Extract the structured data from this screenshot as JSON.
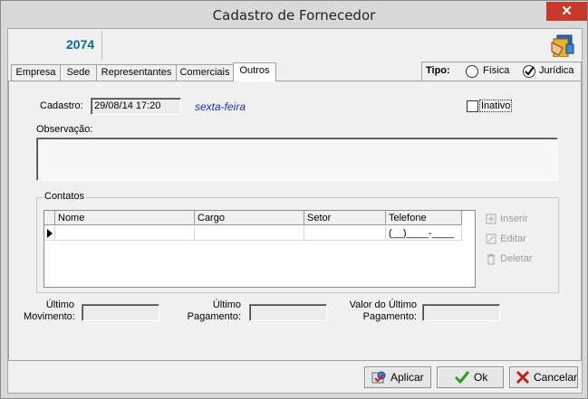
{
  "window": {
    "title": "Cadastro de Fornecedor",
    "close_symbol": "✕"
  },
  "header": {
    "code": "2074"
  },
  "tabs": [
    {
      "label": "Empresa",
      "active": false
    },
    {
      "label": "Sede",
      "active": false
    },
    {
      "label": "Representantes",
      "active": false
    },
    {
      "label": "Comerciais",
      "active": false
    },
    {
      "label": "Outros",
      "active": true
    }
  ],
  "tipo": {
    "label": "Tipo:",
    "options": [
      {
        "label": "Física",
        "selected": false
      },
      {
        "label": "Jurídica",
        "selected": true
      }
    ]
  },
  "cadastro": {
    "label": "Cadastro:",
    "value": "29/08/14 17:20",
    "weekday": "sexta-feira"
  },
  "inativo": {
    "label": "Inativo",
    "checked": false
  },
  "observacao": {
    "label": "Observação:",
    "value": ""
  },
  "contatos": {
    "legend": "Contatos",
    "columns": [
      "Nome",
      "Cargo",
      "Setor",
      "Telefone"
    ],
    "rows": [
      {
        "nome": "",
        "cargo": "",
        "setor": "",
        "telefone": "(__)____-____"
      }
    ],
    "actions": [
      "Inserir",
      "Editar",
      "Deletar"
    ]
  },
  "footer_fields": [
    {
      "label_line1": "Último",
      "label_line2": "Movimento:",
      "value": ""
    },
    {
      "label_line1": "Último",
      "label_line2": "Pagamento:",
      "value": ""
    },
    {
      "label_line1": "Valor do Último",
      "label_line2": "Pagamento:",
      "value": ""
    }
  ],
  "buttons": {
    "aplicar": "Aplicar",
    "ok": "Ok",
    "cancelar": "Cancelar"
  },
  "colors": {
    "accent_code": "#0a6e8a",
    "weekday": "#1a2fa0",
    "close": "#c7392c",
    "ok_check": "#2a9a2a",
    "cancel_x": "#c0201f"
  }
}
